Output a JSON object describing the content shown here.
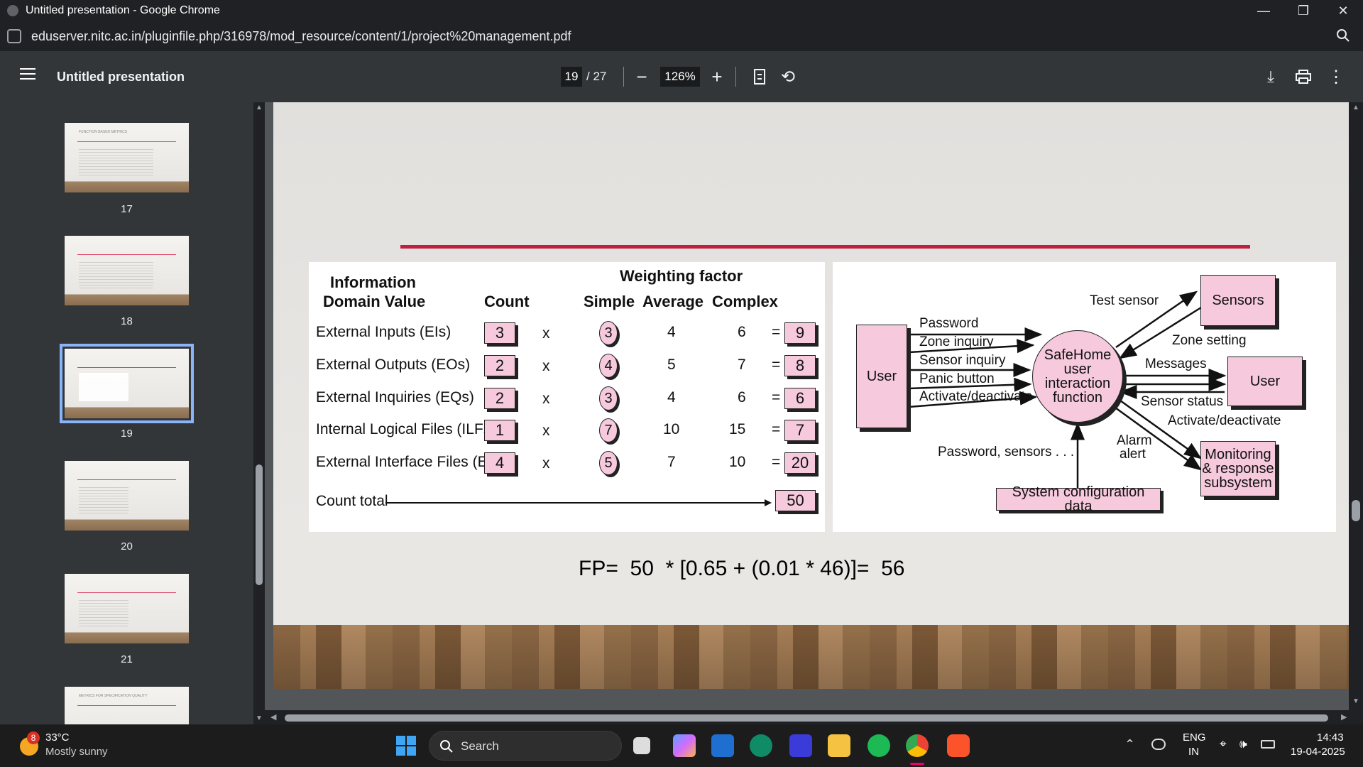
{
  "window": {
    "title": "Untitled presentation - Google Chrome"
  },
  "address": {
    "url": "eduserver.nitc.ac.in/pluginfile.php/316978/mod_resource/content/1/project%20management.pdf"
  },
  "pdf_toolbar": {
    "doc_title": "Untitled presentation",
    "current_page": "19",
    "total_pages": "/ 27",
    "zoom": "126%"
  },
  "thumbnails": [
    {
      "label": "17",
      "title": "FUNCTION BASED METRICS"
    },
    {
      "label": "18",
      "title": ""
    },
    {
      "label": "19",
      "title": ""
    },
    {
      "label": "20",
      "title": ""
    },
    {
      "label": "21",
      "title": ""
    },
    {
      "label": "",
      "title": "METRICS FOR SPECIFICATION QUALITY"
    }
  ],
  "slide": {
    "table": {
      "header_domain": "Information Domain Value",
      "header_domain_1": "Information",
      "header_domain_2": "Domain Value",
      "header_count": "Count",
      "header_weighting": "Weighting factor",
      "header_simple": "Simple",
      "header_average": "Average",
      "header_complex": "Complex",
      "times": "x",
      "equals": "=",
      "rows": [
        {
          "name": "External Inputs (EIs)",
          "count": "3",
          "simple": "3",
          "average": "4",
          "complex": "6",
          "result": "9"
        },
        {
          "name": "External Outputs (EOs)",
          "count": "2",
          "simple": "4",
          "average": "5",
          "complex": "7",
          "result": "8"
        },
        {
          "name": "External Inquiries (EQs)",
          "count": "2",
          "simple": "3",
          "average": "4",
          "complex": "6",
          "result": "6"
        },
        {
          "name": "Internal Logical Files (ILFs)",
          "count": "1",
          "simple": "7",
          "average": "10",
          "complex": "15",
          "result": "7"
        },
        {
          "name": "External Interface Files (EIFs)",
          "count": "4",
          "simple": "5",
          "average": "7",
          "complex": "10",
          "result": "20"
        }
      ],
      "count_total_label": "Count total",
      "count_total": "50"
    },
    "diagram": {
      "user_left": "User",
      "center_1": "SafeHome",
      "center_2": "user",
      "center_3": "interaction",
      "center_4": "function",
      "sensors": "Sensors",
      "user_right": "User",
      "monitor_1": "Monitoring",
      "monitor_2": "& response",
      "monitor_3": "subsystem",
      "sysconfig": "System configuration data",
      "labels": {
        "password": "Password",
        "zone_inquiry": "Zone inquiry",
        "sensor_inquiry": "Sensor inquiry",
        "panic_button": "Panic button",
        "activate_deactivate_in": "Activate/deactivate",
        "test_sensor": "Test sensor",
        "zone_setting": "Zone setting",
        "messages": "Messages",
        "sensor_status": "Sensor status",
        "activate_deactivate_out": "Activate/deactivate",
        "password_sensors": "Password, sensors . . .",
        "alarm_1": "Alarm",
        "alarm_2": "alert"
      }
    },
    "formula": "FP=  50  * [0.65 + (0.01 * 46)]=  56"
  },
  "taskbar": {
    "temperature": "33°C",
    "weather": "Mostly sunny",
    "weather_badge": "8",
    "search_label": "Search",
    "lang_1": "ENG",
    "lang_2": "IN",
    "time": "14:43",
    "date": "19-04-2025"
  }
}
